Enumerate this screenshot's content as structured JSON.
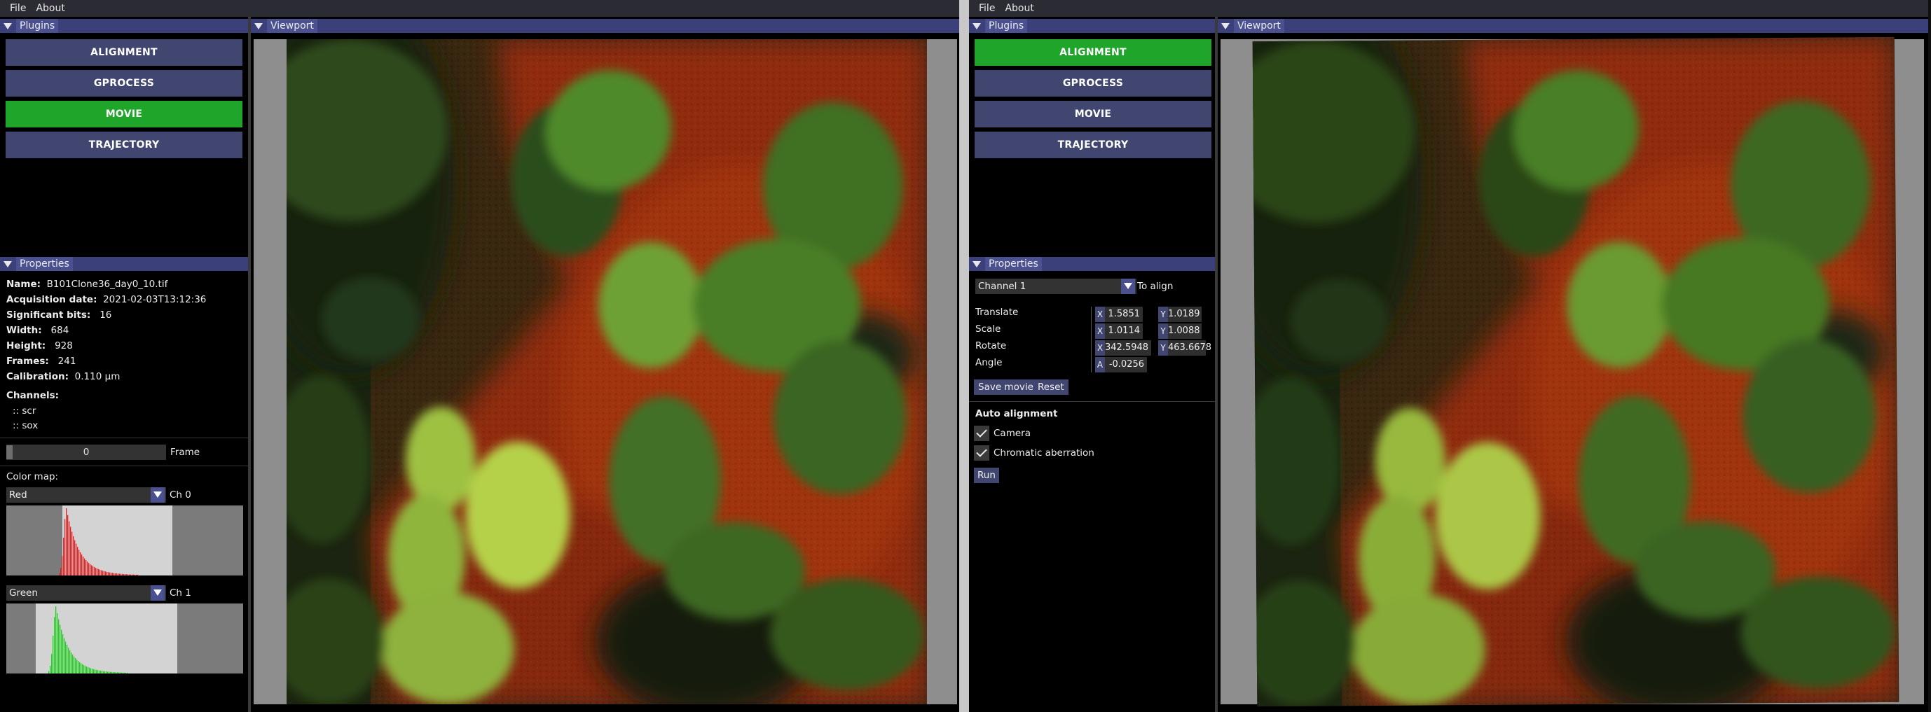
{
  "menu": {
    "file": "File",
    "about": "About"
  },
  "panels": {
    "plugins": "Plugins",
    "properties": "Properties",
    "viewport": "Viewport"
  },
  "left": {
    "plugins": [
      "ALIGNMENT",
      "GPROCESS",
      "MOVIE",
      "TRAJECTORY"
    ],
    "active_plugin": "MOVIE",
    "properties": {
      "name_label": "Name:",
      "name": "B101Clone36_day0_10.tif",
      "acq_label": "Acquisition date:",
      "acq": "2021-02-03T13:12:36",
      "bits_label": "Significant bits:",
      "bits": "16",
      "width_label": "Width:",
      "width": "684",
      "height_label": "Height:",
      "height": "928",
      "frames_label": "Frames:",
      "frames": "241",
      "calib_label": "Calibration:",
      "calib": "0.110 µm",
      "channels_label": "Channels:",
      "channels": [
        ":: scr",
        ":: sox"
      ]
    },
    "frame": {
      "value": "0",
      "label": "Frame",
      "slider_fraction": 0
    },
    "colormap_label": "Color map:",
    "ch0": {
      "map": "Red",
      "label": "Ch 0",
      "color": "#e02020"
    },
    "ch1": {
      "map": "Green",
      "label": "Ch 1",
      "color": "#20d020"
    }
  },
  "right": {
    "plugins": [
      "ALIGNMENT",
      "GPROCESS",
      "MOVIE",
      "TRAJECTORY"
    ],
    "active_plugin": "ALIGNMENT",
    "channel_select": "Channel 1",
    "to_align": "To align",
    "rows": [
      {
        "label": "Translate",
        "a_lbl": "X",
        "a": "1.5851",
        "b_lbl": "Y",
        "b": "1.0189"
      },
      {
        "label": "Scale",
        "a_lbl": "X",
        "a": "1.0114",
        "b_lbl": "Y",
        "b": "1.0088"
      },
      {
        "label": "Rotate",
        "a_lbl": "X",
        "a": "342.5948",
        "b_lbl": "Y",
        "b": "463.6678"
      },
      {
        "label": "Angle",
        "a_lbl": "A",
        "a": "-0.0256"
      }
    ],
    "save_movie": "Save movie",
    "reset": "Reset",
    "auto_alignment": "Auto alignment",
    "camera": "Camera",
    "chromatic": "Chromatic aberration",
    "run": "Run"
  },
  "colors": {
    "accent": "#3b3f7a",
    "button": "#40466f",
    "active": "#1ea52a"
  }
}
